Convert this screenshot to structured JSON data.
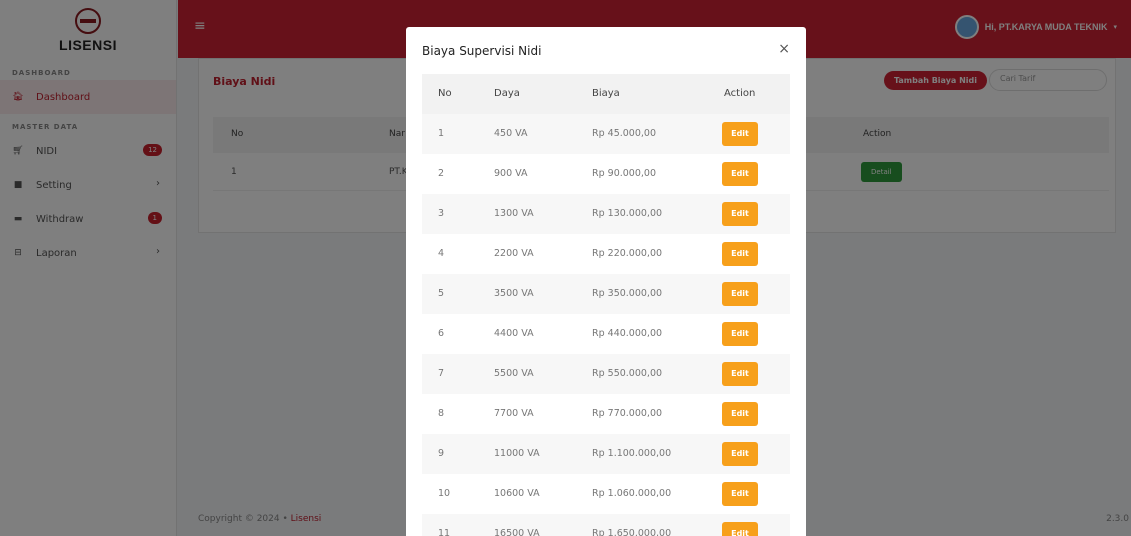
{
  "sidebar": {
    "brand": "LISENSI",
    "section_dashboard": "DASHBOARD",
    "section_master": "MASTER DATA",
    "items": [
      {
        "label": "Dashboard",
        "icon": "home-icon"
      },
      {
        "label": "NIDI",
        "icon": "cart-icon",
        "badge": "12"
      },
      {
        "label": "Setting",
        "icon": "settings-icon"
      },
      {
        "label": "Withdraw",
        "icon": "wallet-icon",
        "badge": "1"
      },
      {
        "label": "Laporan",
        "icon": "report-icon"
      }
    ]
  },
  "topbar": {
    "user_label": "Hi, PT.KARYA MUDA TEKNIK"
  },
  "content": {
    "title": "Biaya Nidi",
    "add_button": "Tambah Biaya Nidi",
    "search_placeholder": "Cari Tarif",
    "table": {
      "headers": [
        "No",
        "Nar",
        "Action"
      ],
      "rows": [
        {
          "no": "1",
          "nama": "PT.K",
          "action": "Detail"
        }
      ]
    }
  },
  "footer": {
    "copyright": "Copyright © 2024 • ",
    "brand": "Lisensi",
    "version": "2.3.0"
  },
  "modal": {
    "title": "Biaya Supervisi Nidi",
    "close": "×",
    "headers": [
      "No",
      "Daya",
      "Biaya",
      "Action"
    ],
    "edit_label": "Edit",
    "rows": [
      {
        "no": "1",
        "daya": "450 VA",
        "biaya": "Rp 45.000,00"
      },
      {
        "no": "2",
        "daya": "900 VA",
        "biaya": "Rp 90.000,00"
      },
      {
        "no": "3",
        "daya": "1300 VA",
        "biaya": "Rp 130.000,00"
      },
      {
        "no": "4",
        "daya": "2200 VA",
        "biaya": "Rp 220.000,00"
      },
      {
        "no": "5",
        "daya": "3500 VA",
        "biaya": "Rp 350.000,00"
      },
      {
        "no": "6",
        "daya": "4400 VA",
        "biaya": "Rp 440.000,00"
      },
      {
        "no": "7",
        "daya": "5500 VA",
        "biaya": "Rp 550.000,00"
      },
      {
        "no": "8",
        "daya": "7700 VA",
        "biaya": "Rp 770.000,00"
      },
      {
        "no": "9",
        "daya": "11000 VA",
        "biaya": "Rp 1.100.000,00"
      },
      {
        "no": "10",
        "daya": "10600 VA",
        "biaya": "Rp 1.060.000,00"
      },
      {
        "no": "11",
        "daya": "16500 VA",
        "biaya": "Rp 1.650.000,00"
      }
    ]
  },
  "colors": {
    "brand_red": "#cf2334",
    "edit_orange": "#f7a01b",
    "detail_green": "#2e9b3d"
  }
}
